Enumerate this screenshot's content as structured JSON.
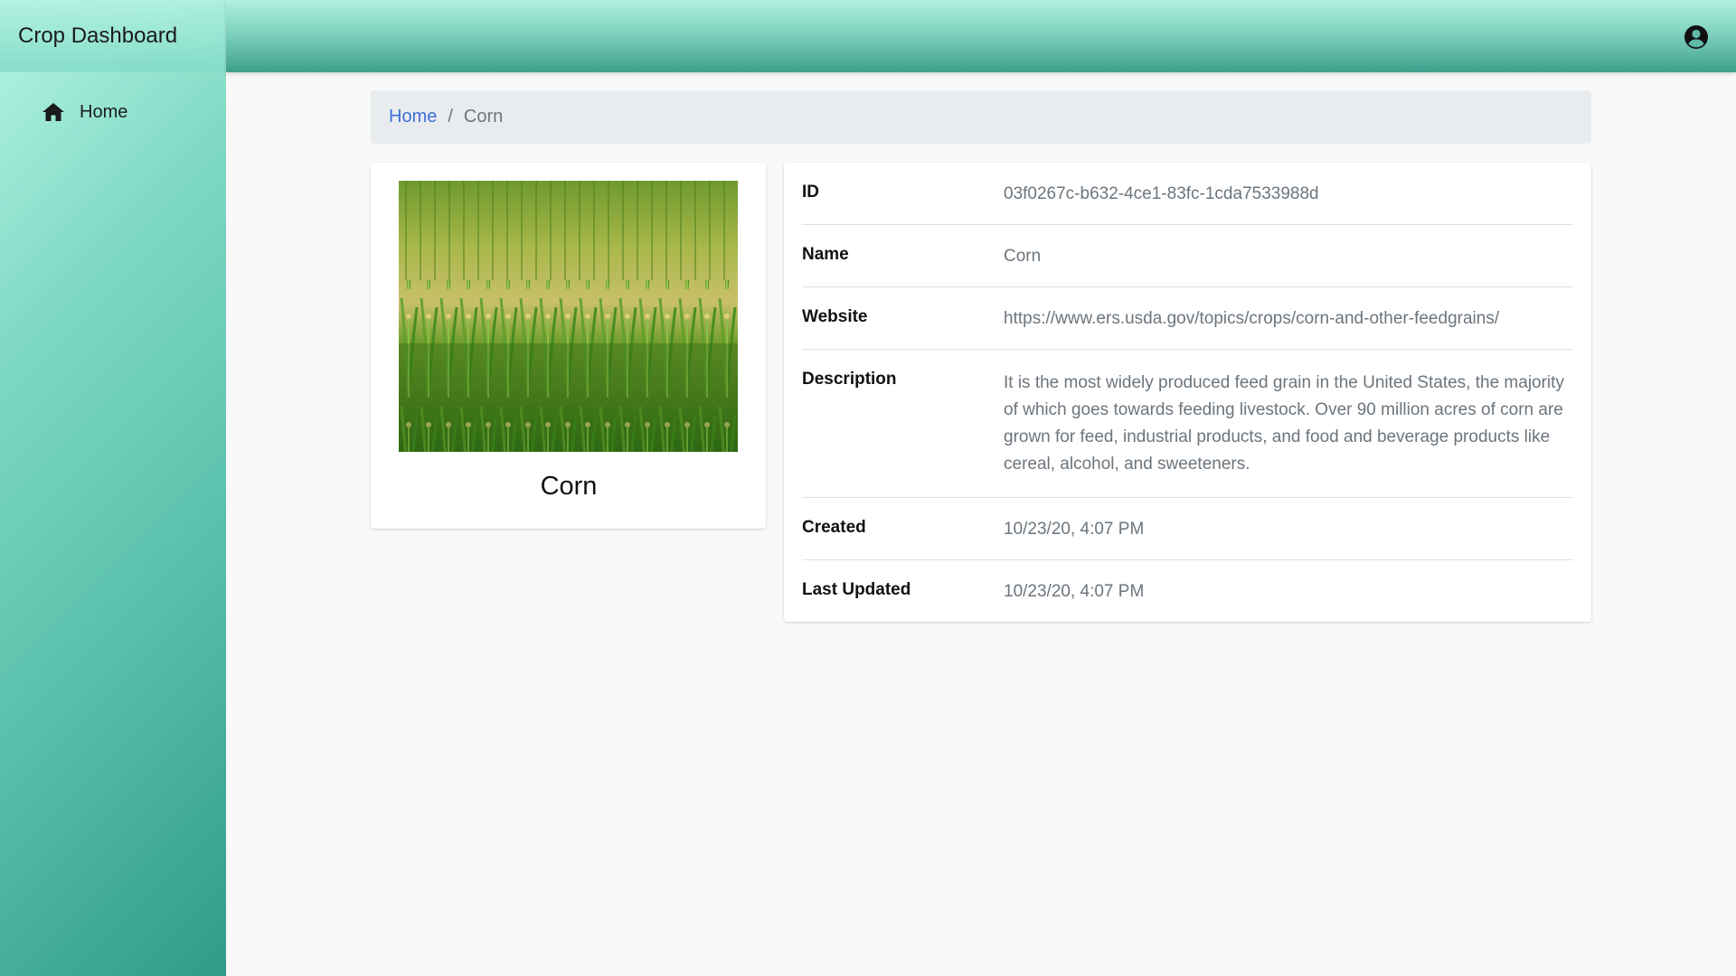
{
  "app": {
    "title": "Crop Dashboard"
  },
  "sidebar": {
    "items": [
      {
        "label": "Home",
        "icon": "home-icon"
      }
    ]
  },
  "topbar": {
    "user_icon": "account-circle-icon"
  },
  "breadcrumb": {
    "home": "Home",
    "current": "Corn"
  },
  "crop": {
    "title": "Corn",
    "image": "corn-field-image"
  },
  "details": {
    "id_label": "ID",
    "id_value": "03f0267c-b632-4ce1-83fc-1cda7533988d",
    "name_label": "Name",
    "name_value": "Corn",
    "website_label": "Website",
    "website_value": "https://www.ers.usda.gov/topics/crops/corn-and-other-feedgrains/",
    "description_label": "Description",
    "description_value": "It is the most widely produced feed grain in the United States, the majority of which goes towards feeding livestock. Over 90 million acres of corn are grown for feed, industrial products, and food and beverage products like cereal, alcohol, and sweeteners.",
    "created_label": "Created",
    "created_value": "10/23/20, 4:07 PM",
    "updated_label": "Last Updated",
    "updated_value": "10/23/20, 4:07 PM"
  },
  "colors": {
    "accent": "#5cc2ad",
    "link": "#3f6fd8",
    "muted_text": "#6c757d"
  }
}
